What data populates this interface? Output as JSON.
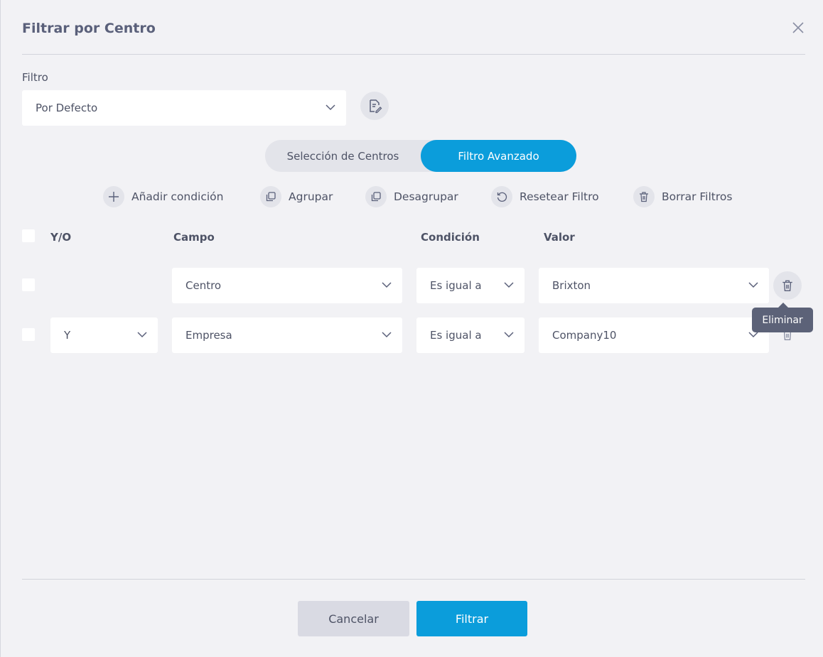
{
  "dialog": {
    "title": "Filtrar por Centro"
  },
  "filter": {
    "label": "Filtro",
    "selected": "Por Defecto"
  },
  "toggle": {
    "option_a": "Selección de Centros",
    "option_b": "Filtro Avanzado",
    "active": "Filtro Avanzado"
  },
  "actions": [
    {
      "label": "Añadir condición",
      "icon": "plus-icon"
    },
    {
      "label": "Agrupar",
      "icon": "group-icon"
    },
    {
      "label": "Desagrupar",
      "icon": "ungroup-icon"
    },
    {
      "label": "Resetear Filtro",
      "icon": "reset-icon"
    },
    {
      "label": "Borrar Filtros",
      "icon": "trash-icon"
    }
  ],
  "table": {
    "headers": {
      "yo": "Y/O",
      "campo": "Campo",
      "condicion": "Condición",
      "valor": "Valor"
    },
    "rows": [
      {
        "yo": "",
        "campo": "Centro",
        "condicion": "Es igual a",
        "valor": "Brixton"
      },
      {
        "yo": "Y",
        "campo": "Empresa",
        "condicion": "Es igual a",
        "valor": "Company10"
      }
    ]
  },
  "tooltip": {
    "text": "Eliminar"
  },
  "footer": {
    "cancel": "Cancelar",
    "submit": "Filtrar"
  },
  "colors": {
    "accent": "#0b9ddb",
    "background": "#f2f2f5",
    "tooltip": "#5c6278"
  }
}
